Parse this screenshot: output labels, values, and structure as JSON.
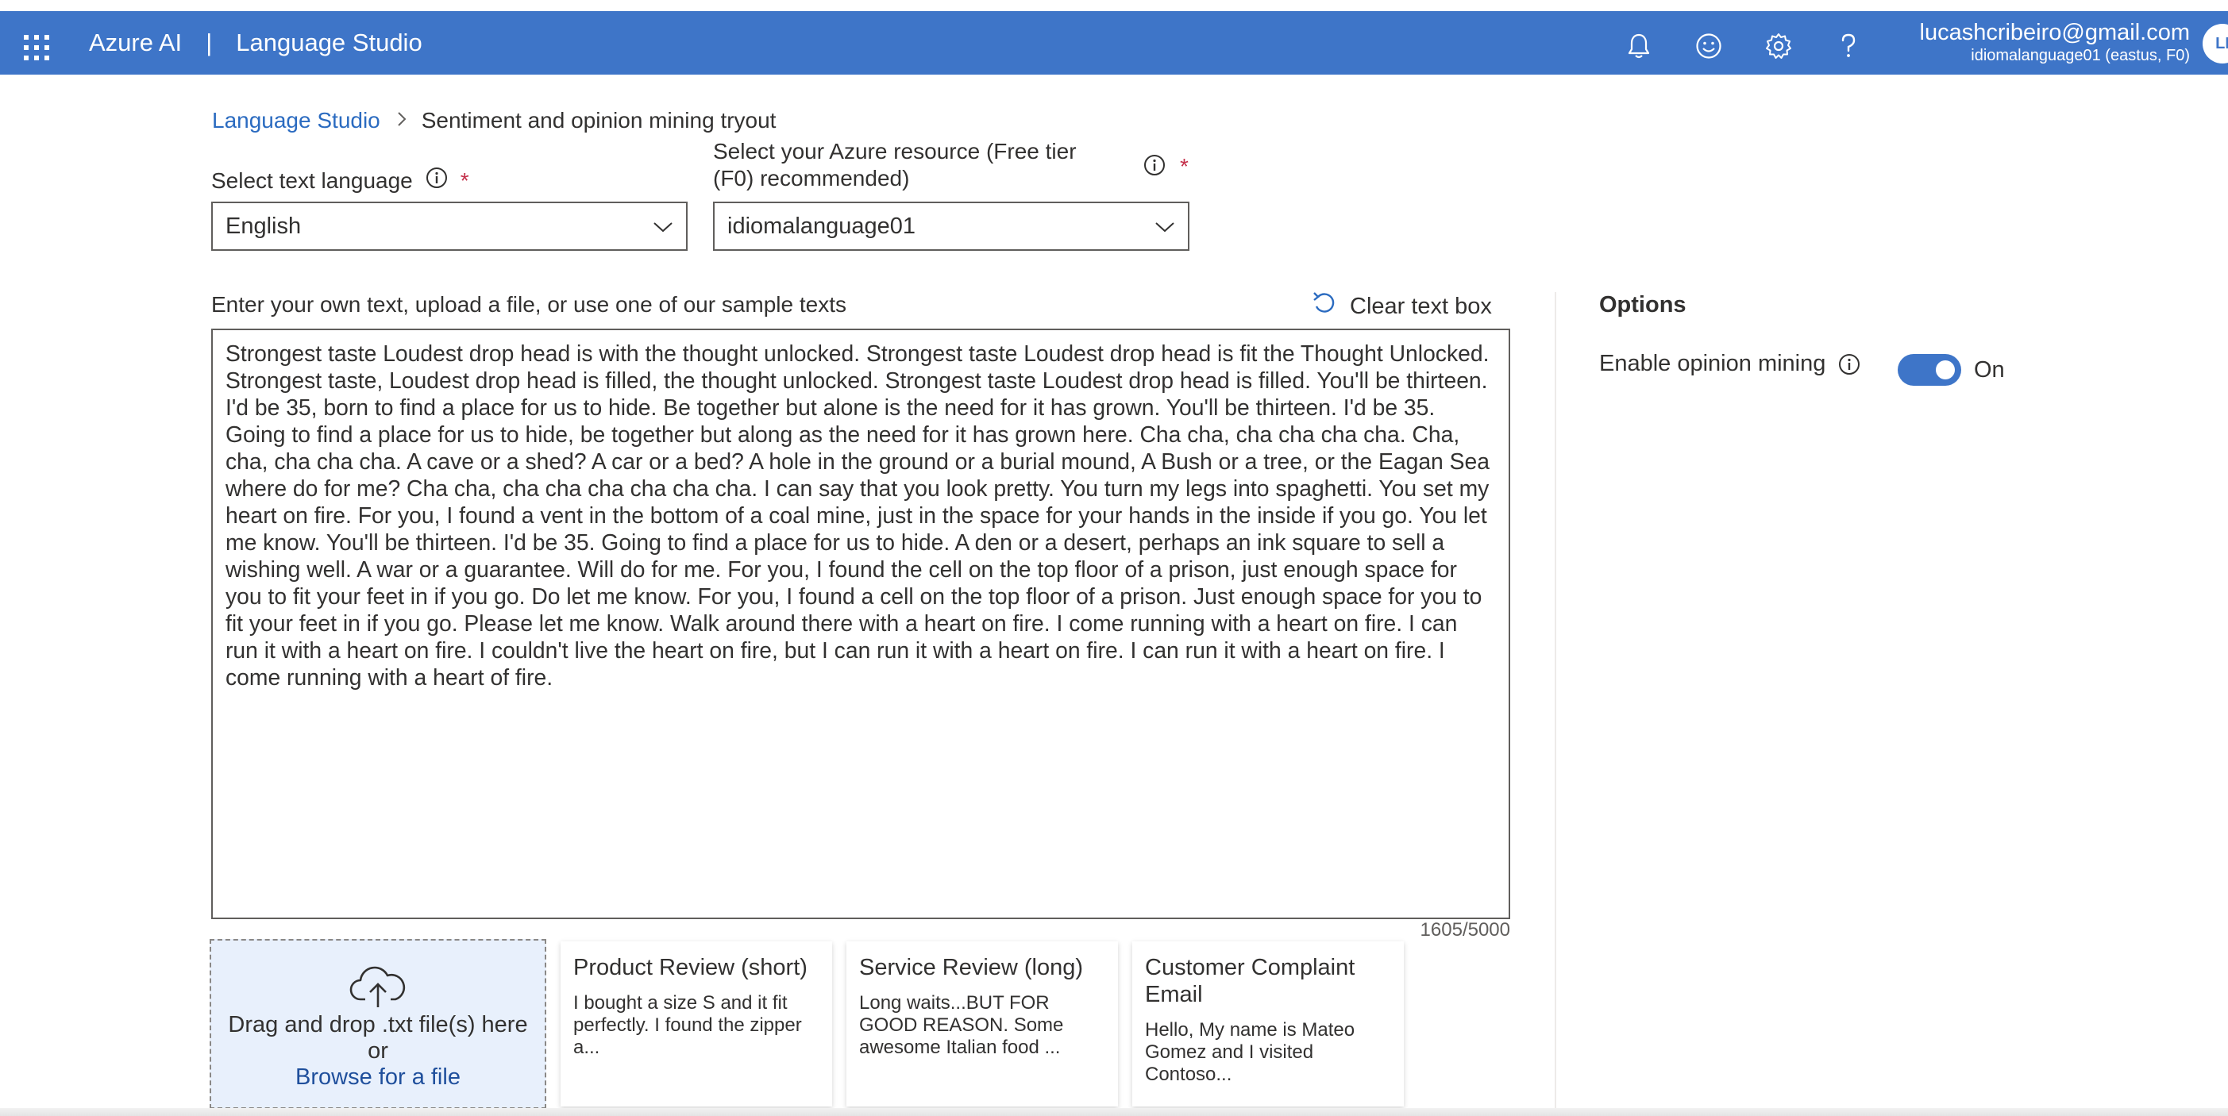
{
  "header": {
    "brand": "Azure AI",
    "separator": "|",
    "product": "Language Studio",
    "email": "lucashcribeiro@gmail.com",
    "resource_info": "idiomalanguage01 (eastus, F0)",
    "avatar_initials": "LI"
  },
  "breadcrumb": {
    "root": "Language Studio",
    "current": "Sentiment and opinion mining tryout"
  },
  "language": {
    "label": "Select text language",
    "required_mark": "*",
    "value": "English"
  },
  "resource": {
    "label_line1": "Select your Azure resource (Free tier",
    "label_line2": "(F0) recommended)",
    "required_mark": "*",
    "value": "idiomalanguage01"
  },
  "input": {
    "heading": "Enter your own text, upload a file, or use one of our sample texts",
    "clear_label": "Clear text box",
    "text": "Strongest taste Loudest drop head is with the thought unlocked. Strongest taste Loudest drop head is fit the Thought Unlocked. Strongest taste, Loudest drop head is filled, the thought unlocked. Strongest taste Loudest drop head is filled. You'll be thirteen. I'd be 35, born to find a place for us to hide. Be together but alone is the need for it has grown. You'll be thirteen. I'd be 35. Going to find a place for us to hide, be together but along as the need for it has grown here. Cha cha, cha cha cha cha. Cha, cha, cha cha cha. A cave or a shed? A car or a bed? A hole in the ground or a burial mound, A Bush or a tree, or the Eagan Sea where do for me? Cha cha, cha cha cha cha cha cha. I can say that you look pretty. You turn my legs into spaghetti. You set my heart on fire. For you, I found a vent in the bottom of a coal mine, just in the space for your hands in the inside if you go. You let me know. You'll be thirteen. I'd be 35. Going to find a place for us to hide. A den or a desert, perhaps an ink square to sell a wishing well. A war or a guarantee. Will do for me. For you, I found the cell on the top floor of a prison, just enough space for you to fit your feet in if you go. Do let me know. For you, I found a cell on the top floor of a prison. Just enough space for you to fit your feet in if you go. Please let me know. Walk around there with a heart on fire. I come running with a heart on fire. I can run it with a heart on fire. I couldn't live the heart on fire, but I can run it with a heart on fire. I can run it with a heart on fire. I come running with a heart of fire.",
    "counter": "1605/5000"
  },
  "upload": {
    "line1": "Drag and drop .txt file(s) here",
    "line2": "or",
    "browse": "Browse for a file"
  },
  "samples": [
    {
      "title": "Product Review (short)",
      "snippet": "I bought a size S and it fit perfectly. I found the zipper a..."
    },
    {
      "title": "Service Review (long)",
      "snippet": "Long waits...BUT FOR GOOD REASON. Some awesome Italian food ..."
    },
    {
      "title": "Customer Complaint Email",
      "snippet": "Hello, My name is Mateo Gomez and I visited Contoso..."
    }
  ],
  "options": {
    "title": "Options",
    "opinion_label": "Enable opinion mining",
    "toggle_state": "On"
  },
  "colors": {
    "header_bg": "#3e75c8",
    "link": "#2b6bc0",
    "required": "#c4314b",
    "drop_bg": "#e8f0fc"
  }
}
